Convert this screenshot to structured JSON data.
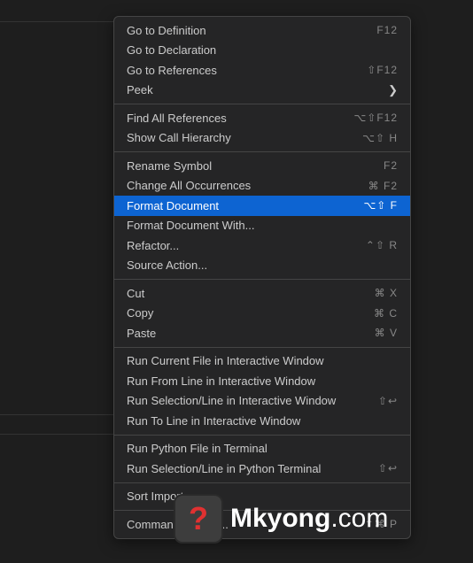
{
  "menu": {
    "groups": [
      [
        {
          "label": "Go to Definition",
          "shortcut": "F12",
          "submenu": false
        },
        {
          "label": "Go to Declaration",
          "shortcut": "",
          "submenu": false
        },
        {
          "label": "Go to References",
          "shortcut": "⇧F12",
          "submenu": false
        },
        {
          "label": "Peek",
          "shortcut": "",
          "submenu": true
        }
      ],
      [
        {
          "label": "Find All References",
          "shortcut": "⌥⇧F12",
          "submenu": false
        },
        {
          "label": "Show Call Hierarchy",
          "shortcut": "⌥⇧ H",
          "submenu": false
        }
      ],
      [
        {
          "label": "Rename Symbol",
          "shortcut": "F2",
          "submenu": false
        },
        {
          "label": "Change All Occurrences",
          "shortcut": "⌘ F2",
          "submenu": false
        },
        {
          "label": "Format Document",
          "shortcut": "⌥⇧ F",
          "submenu": false,
          "highlighted": true
        },
        {
          "label": "Format Document With...",
          "shortcut": "",
          "submenu": false
        },
        {
          "label": "Refactor...",
          "shortcut": "⌃⇧ R",
          "submenu": false
        },
        {
          "label": "Source Action...",
          "shortcut": "",
          "submenu": false
        }
      ],
      [
        {
          "label": "Cut",
          "shortcut": "⌘ X",
          "submenu": false
        },
        {
          "label": "Copy",
          "shortcut": "⌘ C",
          "submenu": false
        },
        {
          "label": "Paste",
          "shortcut": "⌘ V",
          "submenu": false
        }
      ],
      [
        {
          "label": "Run Current File in Interactive Window",
          "shortcut": "",
          "submenu": false
        },
        {
          "label": "Run From Line in Interactive Window",
          "shortcut": "",
          "submenu": false
        },
        {
          "label": "Run Selection/Line in Interactive Window",
          "shortcut": "⇧↩",
          "submenu": false
        },
        {
          "label": "Run To Line in Interactive Window",
          "shortcut": "",
          "submenu": false
        }
      ],
      [
        {
          "label": "Run Python File in Terminal",
          "shortcut": "",
          "submenu": false
        },
        {
          "label": "Run Selection/Line in Python Terminal",
          "shortcut": "⇧↩",
          "submenu": false
        }
      ],
      [
        {
          "label": "Sort Imports",
          "shortcut": "",
          "submenu": false
        }
      ],
      [
        {
          "label": "Command Palette...",
          "shortcut": "⇧⌘ P",
          "submenu": false
        }
      ]
    ]
  },
  "watermark": {
    "icon_char": "?",
    "text_bold": "Mkyong",
    "text_light": ".com"
  }
}
